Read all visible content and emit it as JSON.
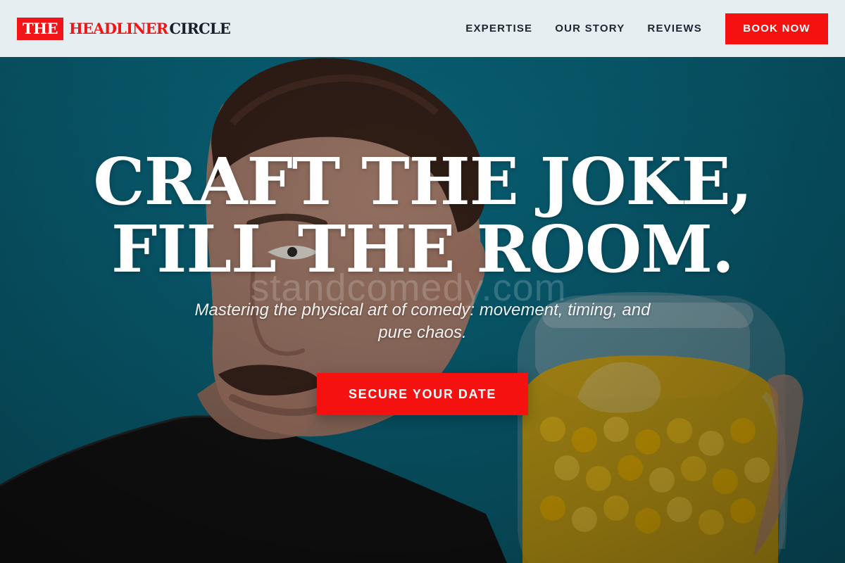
{
  "brand": {
    "logo_part1": "THE",
    "logo_part2": "HEADLINER",
    "logo_part3": "CIRCLE",
    "accent_color": "#f51110"
  },
  "nav": {
    "items": [
      {
        "label": "EXPERTISE"
      },
      {
        "label": "OUR STORY"
      },
      {
        "label": "REVIEWS"
      }
    ],
    "book_label": "BOOK NOW"
  },
  "hero": {
    "headline_line1": "CRAFT THE JOKE,",
    "headline_line2": "FILL THE ROOM.",
    "subtitle": "Mastering the physical art of comedy: movement, timing, and pure chaos.",
    "cta_label": "SECURE YOUR DATE",
    "watermark": "standcomedy.com"
  }
}
